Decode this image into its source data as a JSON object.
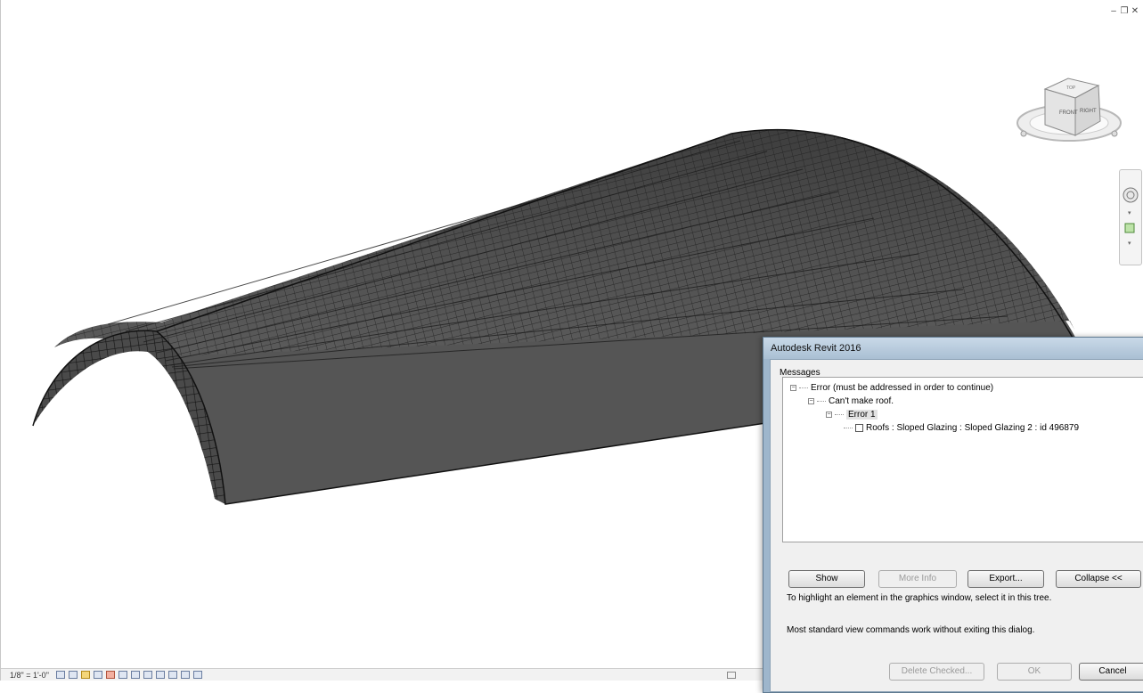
{
  "dialog": {
    "title": "Autodesk Revit 2016",
    "messages_label": "Messages",
    "tree": {
      "root": "Error (must be addressed in order to continue)",
      "child": "Can't make roof.",
      "error": "Error 1",
      "element": "Roofs : Sloped Glazing : Sloped Glazing 2 : id 496879"
    },
    "buttons": {
      "show": "Show",
      "more_info": "More Info",
      "export": "Export...",
      "collapse": "Collapse <<",
      "delete_checked": "Delete Checked...",
      "ok": "OK",
      "cancel": "Cancel"
    },
    "hint_1": "To highlight an element in the graphics window, select it in this tree.",
    "hint_2": "Most standard view commands work without exiting this dialog."
  },
  "viewbar": {
    "scale": "1/8\" = 1'-0\""
  },
  "viewcube": {
    "front": "FRONT",
    "right": "RIGHT",
    "top": "TOP"
  },
  "colors": {
    "roof_fill": "#575757",
    "roof_grid": "#1a1a1a",
    "dialog_frame": "#9eb6cc"
  }
}
